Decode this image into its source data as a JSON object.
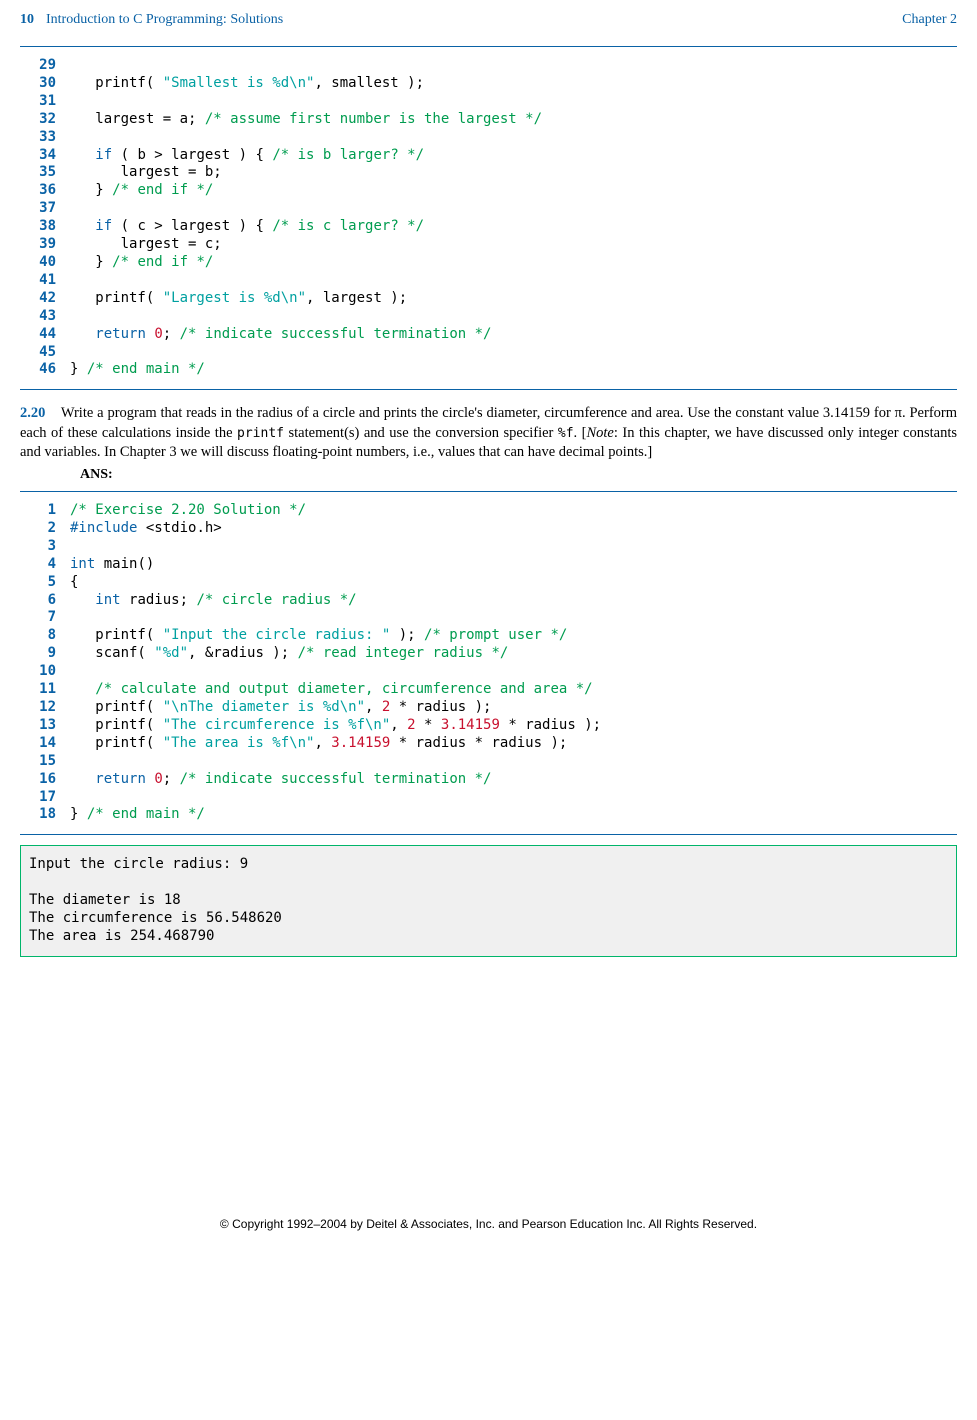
{
  "header": {
    "page_num": "10",
    "title": "Introduction to C Programming: Solutions",
    "chapter": "Chapter  2"
  },
  "code1": {
    "start": 29,
    "lines": [
      [],
      [
        [
          "plain",
          "   printf( "
        ],
        [
          "string",
          "\"Smallest is %d\\n\""
        ],
        [
          "plain",
          ", smallest );"
        ]
      ],
      [],
      [
        [
          "plain",
          "   largest = a; "
        ],
        [
          "comment",
          "/* assume first number is the largest */"
        ]
      ],
      [],
      [
        [
          "plain",
          "   "
        ],
        [
          "keyword",
          "if"
        ],
        [
          "plain",
          " ( b > largest ) { "
        ],
        [
          "comment",
          "/* is b larger? */"
        ]
      ],
      [
        [
          "plain",
          "      largest = b;"
        ]
      ],
      [
        [
          "plain",
          "   } "
        ],
        [
          "comment",
          "/* end if */"
        ]
      ],
      [],
      [
        [
          "plain",
          "   "
        ],
        [
          "keyword",
          "if"
        ],
        [
          "plain",
          " ( c > largest ) { "
        ],
        [
          "comment",
          "/* is c larger? */"
        ]
      ],
      [
        [
          "plain",
          "      largest = c;"
        ]
      ],
      [
        [
          "plain",
          "   } "
        ],
        [
          "comment",
          "/* end if */"
        ]
      ],
      [],
      [
        [
          "plain",
          "   printf( "
        ],
        [
          "string",
          "\"Largest is %d\\n\""
        ],
        [
          "plain",
          ", largest );"
        ]
      ],
      [],
      [
        [
          "plain",
          "   "
        ],
        [
          "keyword",
          "return"
        ],
        [
          "plain",
          " "
        ],
        [
          "number",
          "0"
        ],
        [
          "plain",
          "; "
        ],
        [
          "comment",
          "/* indicate successful termination */"
        ]
      ],
      [],
      [
        [
          "plain",
          "} "
        ],
        [
          "comment",
          "/* end main */"
        ]
      ]
    ]
  },
  "exercise": {
    "num": "2.20",
    "body_parts": [
      "Write a program that reads in the radius of a circle and prints the circle's diameter, circumference and area. Use the constant value 3.14159 for π. Perform each of these calculations inside the ",
      "printf",
      " statement(s) and use the conversion specifier ",
      "%f",
      ". [",
      "Note",
      ": In this chapter, we have discussed only integer constants and variables. In Chapter 3 we will discuss floating-point numbers, i.e., values that can have decimal points.]"
    ],
    "ans_label": "ANS:"
  },
  "code2": {
    "start": 1,
    "lines": [
      [
        [
          "comment",
          "/* Exercise 2.20 Solution */"
        ]
      ],
      [
        [
          "preproc",
          "#include"
        ],
        [
          "plain",
          " "
        ],
        [
          "inc",
          "<stdio.h>"
        ]
      ],
      [],
      [
        [
          "keyword",
          "int"
        ],
        [
          "plain",
          " main()"
        ]
      ],
      [
        [
          "plain",
          "{ "
        ]
      ],
      [
        [
          "plain",
          "   "
        ],
        [
          "keyword",
          "int"
        ],
        [
          "plain",
          " radius; "
        ],
        [
          "comment",
          "/* circle radius */"
        ]
      ],
      [],
      [
        [
          "plain",
          "   printf( "
        ],
        [
          "string",
          "\"Input the circle radius: \""
        ],
        [
          "plain",
          " ); "
        ],
        [
          "comment",
          "/* prompt user */"
        ]
      ],
      [
        [
          "plain",
          "   scanf( "
        ],
        [
          "string",
          "\"%d\""
        ],
        [
          "plain",
          ", &radius ); "
        ],
        [
          "comment",
          "/* read integer radius */"
        ]
      ],
      [],
      [
        [
          "plain",
          "   "
        ],
        [
          "comment",
          "/* calculate and output diameter, circumference and area */"
        ]
      ],
      [
        [
          "plain",
          "   printf( "
        ],
        [
          "string",
          "\"\\nThe diameter is %d\\n\""
        ],
        [
          "plain",
          ", "
        ],
        [
          "number",
          "2"
        ],
        [
          "plain",
          " * radius );"
        ]
      ],
      [
        [
          "plain",
          "   printf( "
        ],
        [
          "string",
          "\"The circumference is %f\\n\""
        ],
        [
          "plain",
          ", "
        ],
        [
          "number",
          "2"
        ],
        [
          "plain",
          " * "
        ],
        [
          "number",
          "3.14159"
        ],
        [
          "plain",
          " * radius );"
        ]
      ],
      [
        [
          "plain",
          "   printf( "
        ],
        [
          "string",
          "\"The area is %f\\n\""
        ],
        [
          "plain",
          ", "
        ],
        [
          "number",
          "3.14159"
        ],
        [
          "plain",
          " * radius * radius );"
        ]
      ],
      [],
      [
        [
          "plain",
          "   "
        ],
        [
          "keyword",
          "return"
        ],
        [
          "plain",
          " "
        ],
        [
          "number",
          "0"
        ],
        [
          "plain",
          "; "
        ],
        [
          "comment",
          "/* indicate successful termination */"
        ]
      ],
      [],
      [
        [
          "plain",
          "} "
        ],
        [
          "comment",
          "/* end main */"
        ]
      ]
    ]
  },
  "output": "Input the circle radius: 9\n\nThe diameter is 18\nThe circumference is 56.548620\nThe area is 254.468790",
  "footer": "© Copyright 1992–2004 by Deitel & Associates, Inc. and Pearson Education Inc. All Rights Reserved."
}
